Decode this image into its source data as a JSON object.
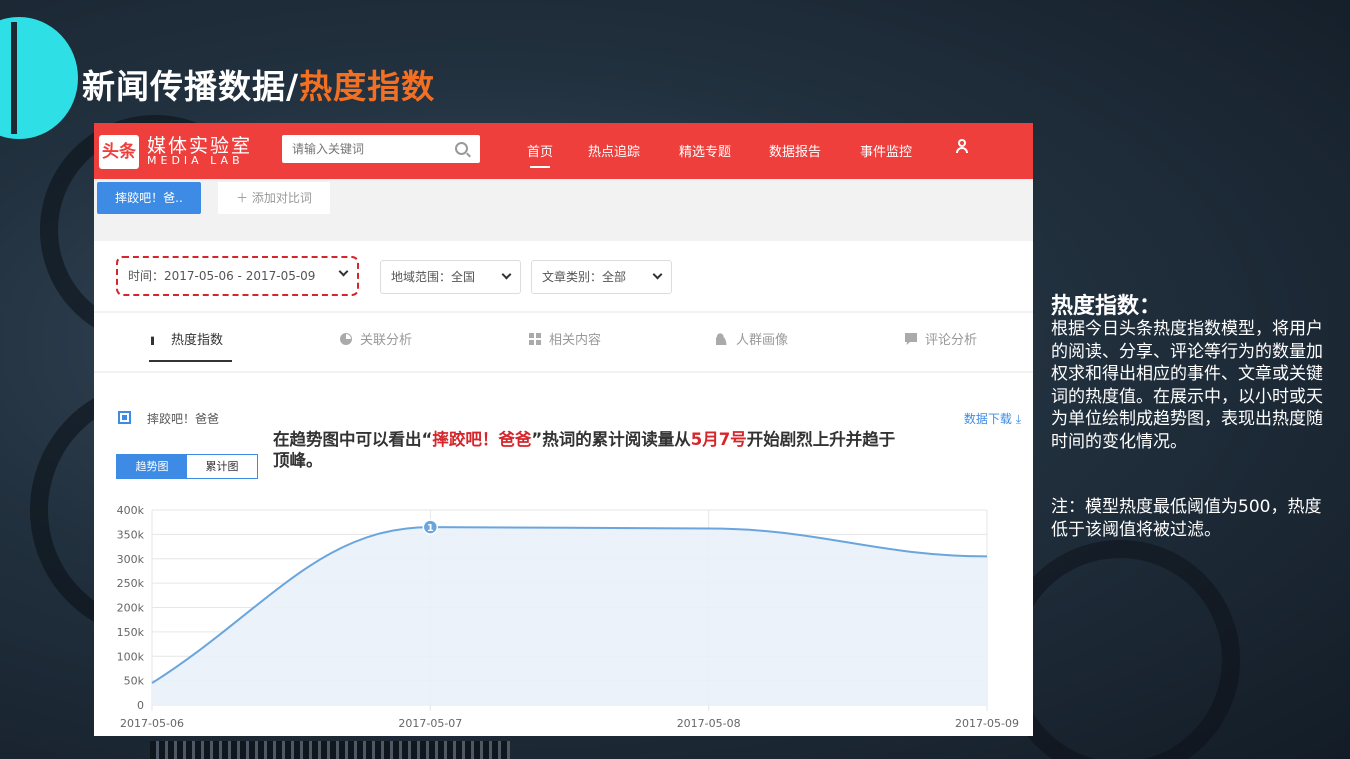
{
  "slide": {
    "title_plain": "新闻传播数据/",
    "title_highlight": "热度指数"
  },
  "app": {
    "logo_icon_text": "头条",
    "logo_cn": "媒体实验室",
    "logo_en": "MEDIA LAB",
    "search_placeholder": "请输入关键词",
    "nav": [
      "首页",
      "热点追踪",
      "精选专题",
      "数据报告",
      "事件监控"
    ],
    "keyword_tab": "摔跤吧！爸..",
    "add_compare": "＋ 添加对比词",
    "filters": {
      "date": "时间：2017-05-06 - 2017-05-09",
      "region": "地域范围：全国",
      "category": "文章类别：全部"
    },
    "tabs": [
      "热度指数",
      "关联分析",
      "相关内容",
      "人群画像",
      "评论分析"
    ],
    "legend": "摔跤吧！爸爸",
    "download": "数据下载 ⤓",
    "toggle_trend": "趋势图",
    "toggle_cumulative": "累计图",
    "annotation": {
      "part1": "在趋势图中可以看出“",
      "keyword": "摔跤吧！爸爸",
      "part2": "”热词的累计阅读量从",
      "date": "5月7号",
      "part3": "开始剧烈上升并趋于顶峰。"
    }
  },
  "chart_data": {
    "type": "area",
    "x": [
      "2017-05-06",
      "2017-05-07",
      "2017-05-08",
      "2017-05-09"
    ],
    "series": [
      {
        "values": [
          45000,
          365000,
          362000,
          305000
        ]
      }
    ],
    "ylim": [
      0,
      400000
    ],
    "y_ticks": [
      "0",
      "50k",
      "100k",
      "150k",
      "200k",
      "250k",
      "300k",
      "350k",
      "400k"
    ],
    "y_tick_values": [
      0,
      50000,
      100000,
      150000,
      200000,
      250000,
      300000,
      350000,
      400000
    ],
    "marker": {
      "index": 1,
      "label": "1"
    },
    "color": "#6aa5de",
    "grid": true
  },
  "side": {
    "title": "热度指数：",
    "body": "根据今日头条热度指数模型，将用户的阅读、分享、评论等行为的数量加权求和得出相应的事件、文章或关键词的热度值。在展示中，以小时或天为单位绘制成趋势图，表现出热度随时间的变化情况。",
    "note": "注：模型热度最低阈值为500，热度低于该阈值将被过滤。"
  }
}
